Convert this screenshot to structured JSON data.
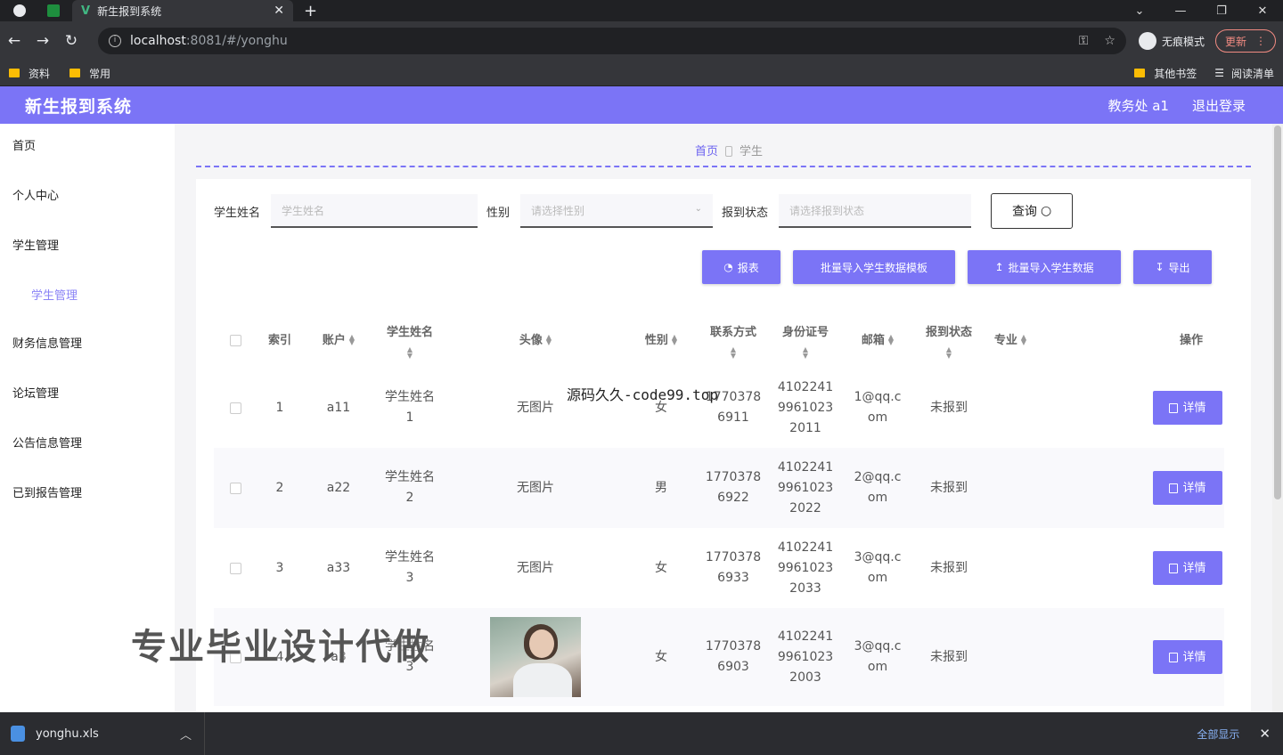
{
  "browser": {
    "tab_title": "新生报到系统",
    "new_tab": "+",
    "url_host": "localhost",
    "url_path": ":8081/#/yonghu",
    "incognito_label": "无痕模式",
    "update_label": "更新",
    "bookmarks": [
      "资料",
      "常用"
    ],
    "bookmarks_right": [
      "其他书签",
      "阅读清单"
    ]
  },
  "header": {
    "title": "新生报到系统",
    "user": "教务处 a1",
    "logout": "退出登录"
  },
  "sidebar": {
    "items": [
      {
        "label": "首页"
      },
      {
        "label": "个人中心"
      },
      {
        "label": "学生管理"
      },
      {
        "label": "学生管理",
        "sub": true
      },
      {
        "label": "财务信息管理"
      },
      {
        "label": "论坛管理"
      },
      {
        "label": "公告信息管理"
      },
      {
        "label": "已到报告管理"
      }
    ]
  },
  "breadcrumb": {
    "home": "首页",
    "current": "学生"
  },
  "search": {
    "name_label": "学生姓名",
    "name_placeholder": "学生姓名",
    "sex_label": "性别",
    "sex_placeholder": "请选择性别",
    "status_label": "报到状态",
    "status_placeholder": "请选择报到状态",
    "query_button": "查询"
  },
  "actions": {
    "report": "报表",
    "import_template": "批量导入学生数据模板",
    "import_data": "批量导入学生数据",
    "export": "导出"
  },
  "table": {
    "columns": {
      "index": "索引",
      "account": "账户",
      "name": "学生姓名",
      "avatar": "头像",
      "sex": "性别",
      "phone": "联系方式",
      "idcard": "身份证号",
      "email": "邮箱",
      "status": "报到状态",
      "major": "专业",
      "ops": "操作"
    },
    "detail_label": "详情",
    "rows": [
      {
        "index": "1",
        "account": "a11",
        "name1": "学生姓名",
        "name2": "1",
        "avatar": "无图片",
        "sex": "女",
        "phone1": "1770378",
        "phone2": "6911",
        "id1": "4102241",
        "id2": "9961023",
        "id3": "2011",
        "mail1": "1@qq.c",
        "mail2": "om",
        "status": "未报到"
      },
      {
        "index": "2",
        "account": "a22",
        "name1": "学生姓名",
        "name2": "2",
        "avatar": "无图片",
        "sex": "男",
        "phone1": "1770378",
        "phone2": "6922",
        "id1": "4102241",
        "id2": "9961023",
        "id3": "2022",
        "mail1": "2@qq.c",
        "mail2": "om",
        "status": "未报到"
      },
      {
        "index": "3",
        "account": "a33",
        "name1": "学生姓名",
        "name2": "3",
        "avatar": "无图片",
        "sex": "女",
        "phone1": "1770378",
        "phone2": "6933",
        "id1": "4102241",
        "id2": "9961023",
        "id3": "2033",
        "mail1": "3@qq.c",
        "mail2": "om",
        "status": "未报到"
      },
      {
        "index": "4",
        "account": "a3",
        "name1": "学生姓名",
        "name2": "3",
        "avatar": "",
        "sex": "女",
        "phone1": "1770378",
        "phone2": "6903",
        "id1": "4102241",
        "id2": "9961023",
        "id3": "2003",
        "mail1": "3@qq.c",
        "mail2": "om",
        "status": "未报到"
      }
    ]
  },
  "overlay": {
    "watermark_text": "源码久久-code99.top",
    "ad_text": "专业毕业设计代做"
  },
  "download_bar": {
    "file": "yonghu.xls",
    "show_all": "全部显示"
  },
  "colors": {
    "accent": "#7b74f6",
    "chrome": "#35363a"
  }
}
